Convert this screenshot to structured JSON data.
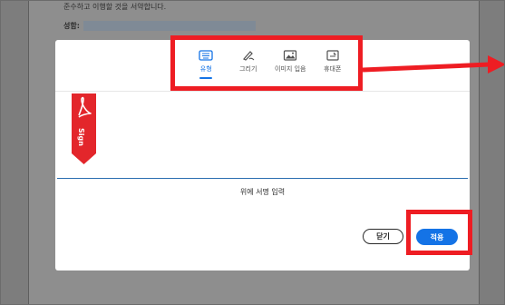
{
  "document": {
    "line": "준수하고 이행할 것을 서약합니다.",
    "signature_label": "성함:"
  },
  "signature_dialog": {
    "tabs": [
      {
        "label": "유형",
        "icon": "keyboard-icon",
        "active": true
      },
      {
        "label": "그리기",
        "icon": "pen-icon",
        "active": false
      },
      {
        "label": "이미지 입음",
        "icon": "image-icon",
        "active": false
      },
      {
        "label": "휴대폰",
        "icon": "mobile-icon",
        "active": false
      }
    ],
    "sign_tag_text": "Sign",
    "hint": "위에 서명 입력",
    "close_label": "닫기",
    "apply_label": "적용"
  },
  "colors": {
    "accent": "#1473e6",
    "annotation": "#ee1d23",
    "adobe_red": "#e3262b"
  }
}
